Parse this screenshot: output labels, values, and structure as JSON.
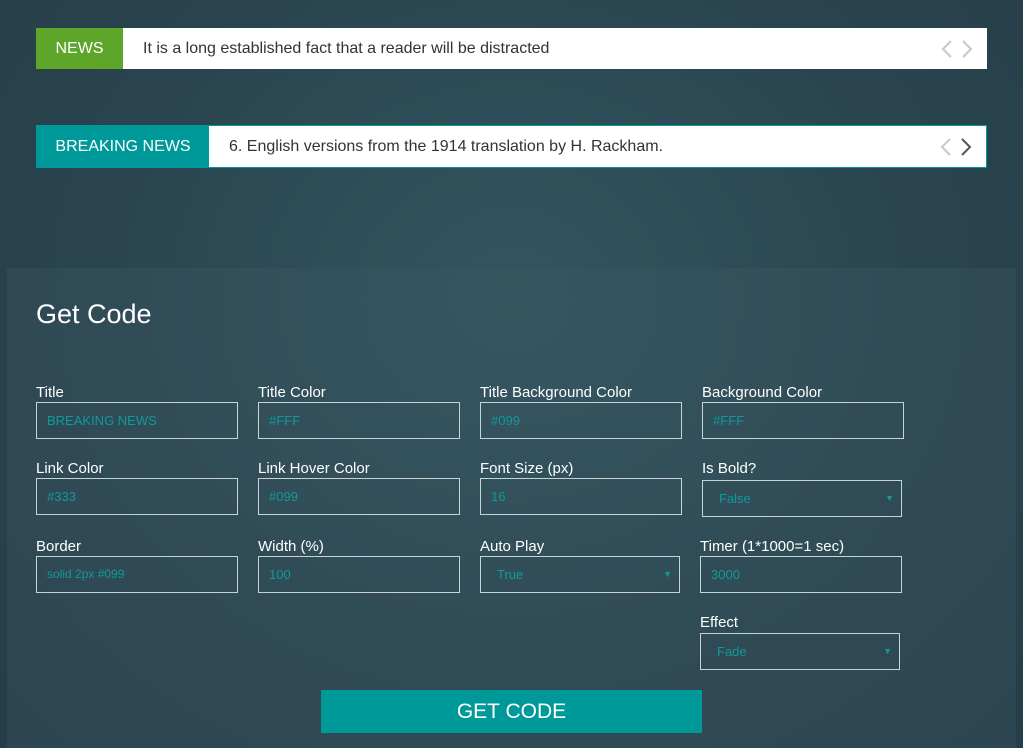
{
  "ticker1": {
    "label": "NEWS",
    "text": "It is a long established fact that a reader will be distracted"
  },
  "ticker2": {
    "label": "BREAKING NEWS",
    "text": "6. English versions from the 1914 translation by H. Rackham."
  },
  "form": {
    "heading": "Get Code",
    "fields": {
      "title": {
        "label": "Title",
        "value": "BREAKING NEWS"
      },
      "title_color": {
        "label": "Title Color",
        "value": "#FFF"
      },
      "title_bg": {
        "label": "Title Background Color",
        "value": "#099"
      },
      "bg_color": {
        "label": "Background Color",
        "value": "#FFF"
      },
      "link_color": {
        "label": "Link Color",
        "value": "#333"
      },
      "link_hover": {
        "label": "Link Hover Color",
        "value": "#099"
      },
      "font_size": {
        "label": "Font Size (px)",
        "value": "16"
      },
      "is_bold": {
        "label": "Is Bold?",
        "value": "False"
      },
      "border": {
        "label": "Border",
        "value": "solid 2px #099"
      },
      "width": {
        "label": "Width (%)",
        "value": "100"
      },
      "auto_play": {
        "label": "Auto Play",
        "value": "True"
      },
      "timer": {
        "label": "Timer (1*1000=1 sec)",
        "value": "3000"
      },
      "effect": {
        "label": "Effect",
        "value": "Fade"
      }
    },
    "button": "GET CODE"
  },
  "colors": {
    "news_green": "#5ea62a",
    "accent_teal": "#009999",
    "input_text": "#109a9a"
  }
}
